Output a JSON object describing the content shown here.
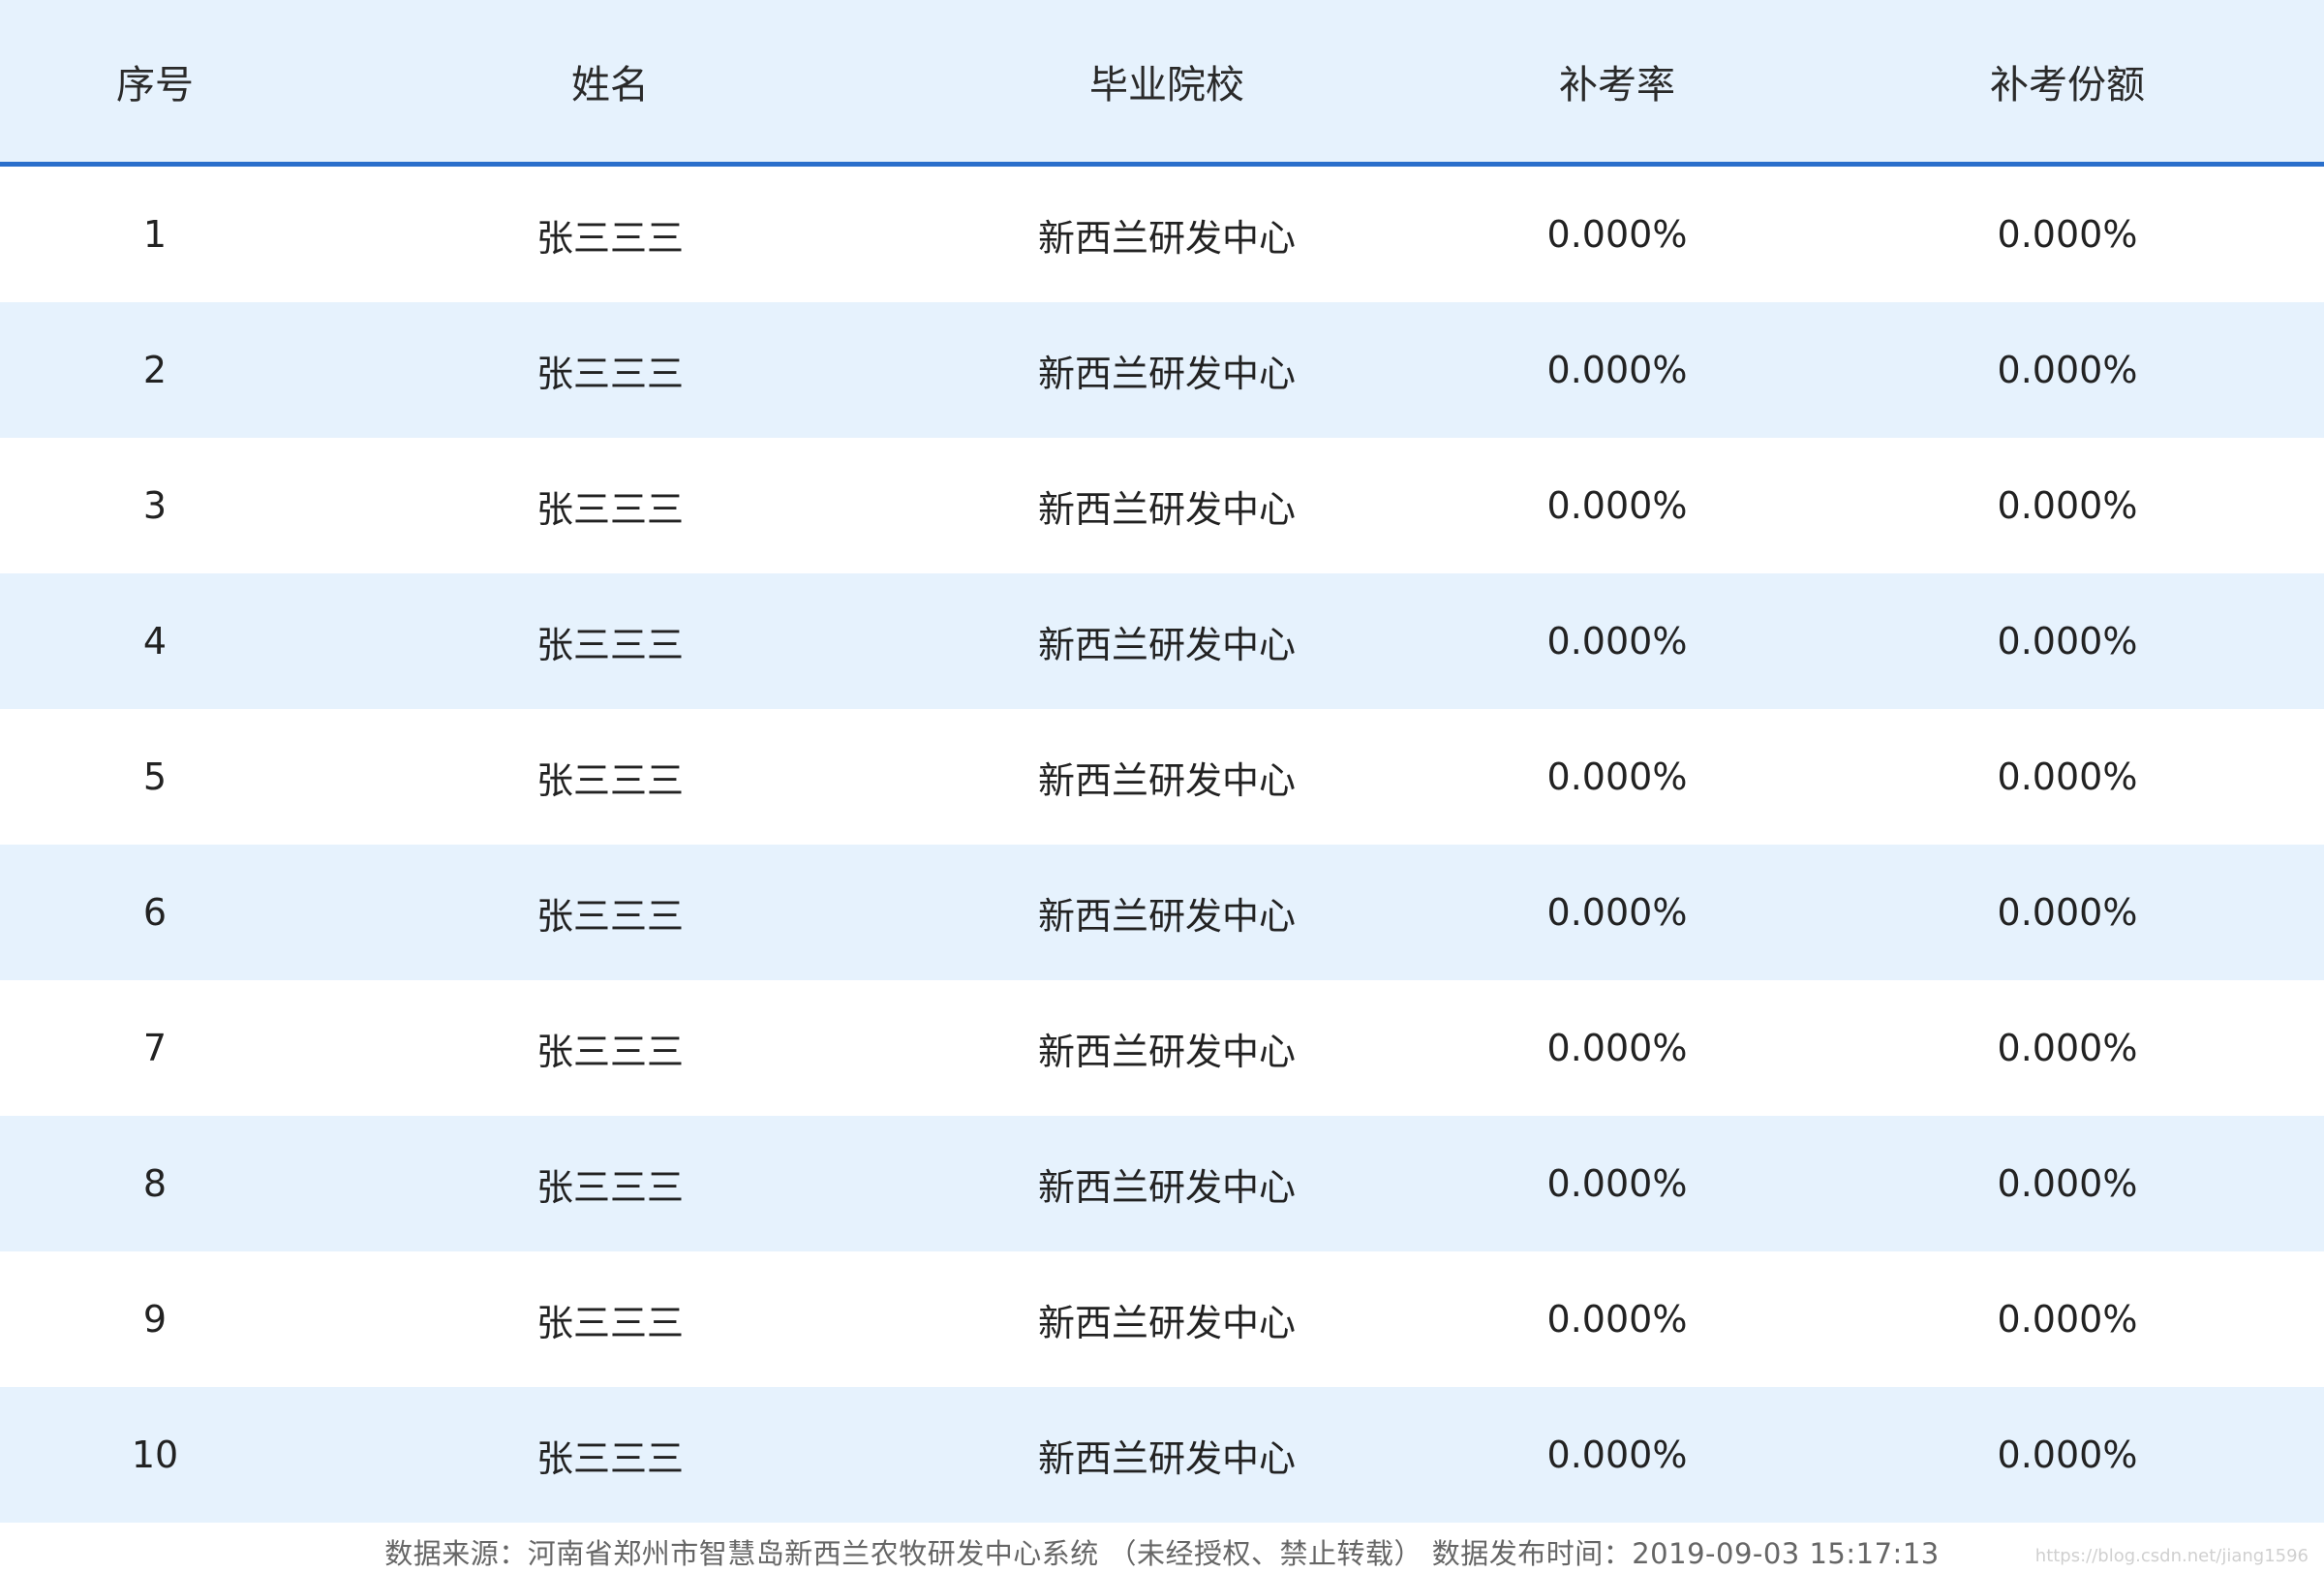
{
  "table": {
    "headers": [
      "序号",
      "姓名",
      "毕业院校",
      "补考率",
      "补考份额"
    ],
    "rows": [
      [
        "1",
        "张三三三",
        "新西兰研发中心",
        "0.000%",
        "0.000%"
      ],
      [
        "2",
        "张三三三",
        "新西兰研发中心",
        "0.000%",
        "0.000%"
      ],
      [
        "3",
        "张三三三",
        "新西兰研发中心",
        "0.000%",
        "0.000%"
      ],
      [
        "4",
        "张三三三",
        "新西兰研发中心",
        "0.000%",
        "0.000%"
      ],
      [
        "5",
        "张三三三",
        "新西兰研发中心",
        "0.000%",
        "0.000%"
      ],
      [
        "6",
        "张三三三",
        "新西兰研发中心",
        "0.000%",
        "0.000%"
      ],
      [
        "7",
        "张三三三",
        "新西兰研发中心",
        "0.000%",
        "0.000%"
      ],
      [
        "8",
        "张三三三",
        "新西兰研发中心",
        "0.000%",
        "0.000%"
      ],
      [
        "9",
        "张三三三",
        "新西兰研发中心",
        "0.000%",
        "0.000%"
      ],
      [
        "10",
        "张三三三",
        "新西兰研发中心",
        "0.000%",
        "0.000%"
      ]
    ]
  },
  "footer": {
    "text": "数据来源：河南省郑州市智慧岛新西兰农牧研发中心系统 （未经授权、禁止转载） 数据发布时间：2019-09-03 15:17:13",
    "watermark": "https://blog.csdn.net/jiang1596"
  },
  "colors": {
    "header_bg": "#e6f2fd",
    "header_border": "#2a6fcb",
    "alt_row_bg": "#e6f2fd",
    "row_bg": "#ffffff"
  }
}
